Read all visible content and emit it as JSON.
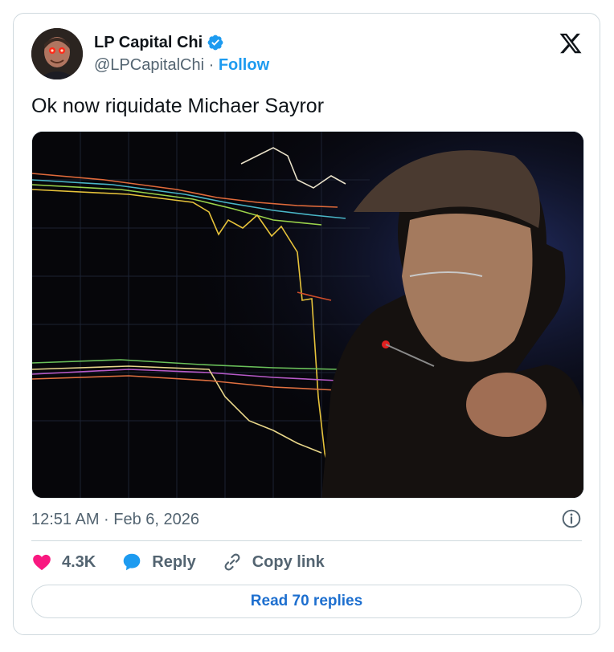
{
  "author": {
    "name": "LP Capital Chi",
    "handle": "@LPCapitalChi",
    "separator": "·",
    "follow_label": "Follow",
    "verified": true
  },
  "tweet": {
    "text": "Ok now riquidate Michaer Sayror",
    "timestamp": "12:51 AM · Feb 6, 2026"
  },
  "actions": {
    "likes": "4.3K",
    "reply_label": "Reply",
    "copy_link_label": "Copy link"
  },
  "read_replies_label": "Read 70 replies",
  "colors": {
    "accent_blue": "#1d9bf0",
    "like_pink": "#f91880",
    "text_secondary": "#536471"
  },
  "icons": [
    "x-logo-icon",
    "verified-badge-icon",
    "info-icon",
    "heart-icon",
    "reply-bubble-icon",
    "link-icon"
  ]
}
